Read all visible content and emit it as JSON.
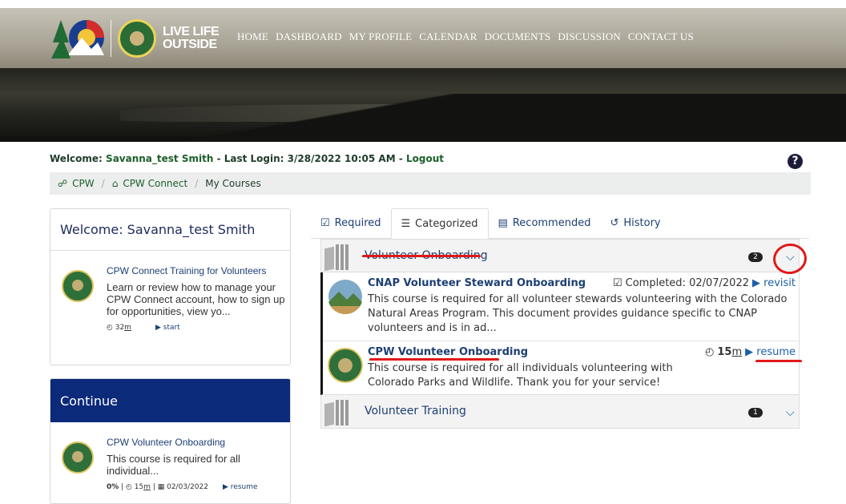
{
  "header": {
    "logo_text_line1": "LIVE LIFE",
    "logo_text_line2": "OUTSIDE",
    "nav": [
      "HOME",
      "DASHBOARD",
      "MY PROFILE",
      "CALENDAR",
      "DOCUMENTS",
      "DISCUSSION",
      "CONTACT US"
    ]
  },
  "welcome": {
    "prefix": "Welcome:",
    "user": "Savanna_test Smith",
    "last_login_label": "- Last Login:",
    "last_login": "3/28/2022 10:05 AM",
    "dash": "-",
    "logout": "Logout"
  },
  "breadcrumb": [
    "CPW",
    "CPW Connect",
    "My Courses"
  ],
  "left": {
    "welcome_card_title": "Welcome: Savanna_test Smith",
    "course": {
      "title": "CPW Connect Training for Volunteers",
      "desc": "Learn or review how to manage your CPW Connect account, how to sign up for opportunities, view yo...",
      "time": "32",
      "time_unit": "m",
      "action": "start"
    },
    "continue_title": "Continue",
    "continue_course": {
      "title": "CPW Volunteer Onboarding",
      "desc": "This course is required for all individual...",
      "progress": "0%",
      "time": "15",
      "time_unit": "m",
      "date": "02/03/2022",
      "action": "resume"
    }
  },
  "tabs": [
    "Required",
    "Categorized",
    "Recommended",
    "History"
  ],
  "categories": [
    {
      "title": "Volunteer Onboarding",
      "count": "2",
      "courses": [
        {
          "title": "CNAP Volunteer Steward Onboarding",
          "desc": "This course is required for all volunteer stewards volunteering with the Colorado Natural Areas Program. This document provides guidance specific to CNAP volunteers and is in ad...",
          "status": "Completed: 02/07/2022",
          "action": "revisit"
        },
        {
          "title": "CPW Volunteer Onboarding",
          "desc": "This course is required for all individuals volunteering with Colorado Parks and Wildlife. Thank you for your service!",
          "time": "15",
          "time_unit": "m",
          "action": "resume"
        }
      ]
    },
    {
      "title": "Volunteer Training",
      "count": "1"
    }
  ],
  "colors": {
    "accent_red": "#e01818",
    "navy": "#0b2a7a",
    "link": "#1d3f73"
  }
}
